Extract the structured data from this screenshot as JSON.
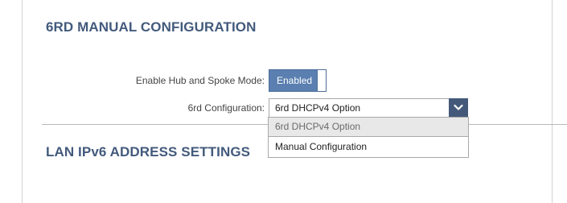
{
  "sections": {
    "manual_config_title": "6RD MANUAL CONFIGURATION",
    "lan_title": "LAN IPv6 ADDRESS SETTINGS"
  },
  "hub_spoke": {
    "label": "Enable Hub and Spoke Mode:",
    "state": "Enabled"
  },
  "config": {
    "label": "6rd Configuration:",
    "selected": "6rd DHCPv4 Option",
    "options": [
      "6rd DHCPv4 Option",
      "Manual Configuration"
    ]
  },
  "colors": {
    "heading": "#435a7c",
    "toggle_on": "#5a7fb0",
    "select_button": "#44597a"
  },
  "icons": {
    "select_arrow": "chevron-down-icon"
  }
}
